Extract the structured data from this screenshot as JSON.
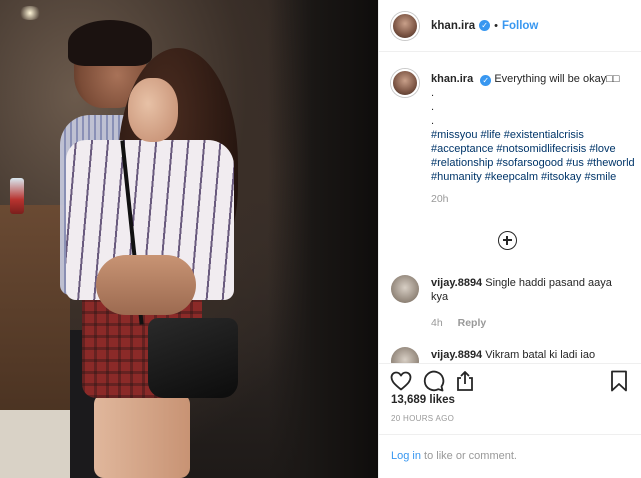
{
  "header": {
    "username": "khan.ira",
    "separator": "•",
    "follow_label": "Follow"
  },
  "caption": {
    "username": "khan.ira",
    "text": "Everything will be okay□□",
    "dots": [
      ".",
      ".",
      "."
    ],
    "hashtags": "#missyou #life #existentialcrisis #acceptance #notsomidlifecrisis #love #relationship #sofarsogood #us #theworld #humanity #keepcalm #itsokay #smile",
    "age": "20h"
  },
  "comments": [
    {
      "username": "vijay.8894",
      "text": "Single haddi pasand aaya kya",
      "age": "4h",
      "reply_label": "Reply"
    },
    {
      "username": "vijay.8894",
      "text": "Vikram batal ki ladi iao"
    }
  ],
  "actions": {
    "icons": [
      "heart-icon",
      "comment-icon",
      "share-icon",
      "bookmark-icon"
    ]
  },
  "likes": "13,689 likes",
  "timestamp": "20 HOURS AGO",
  "login": {
    "link": "Log in",
    "rest": " to like or comment."
  },
  "colors": {
    "accent": "#3897f0",
    "text": "#262626",
    "muted": "#999999",
    "hashtag": "#003569"
  }
}
